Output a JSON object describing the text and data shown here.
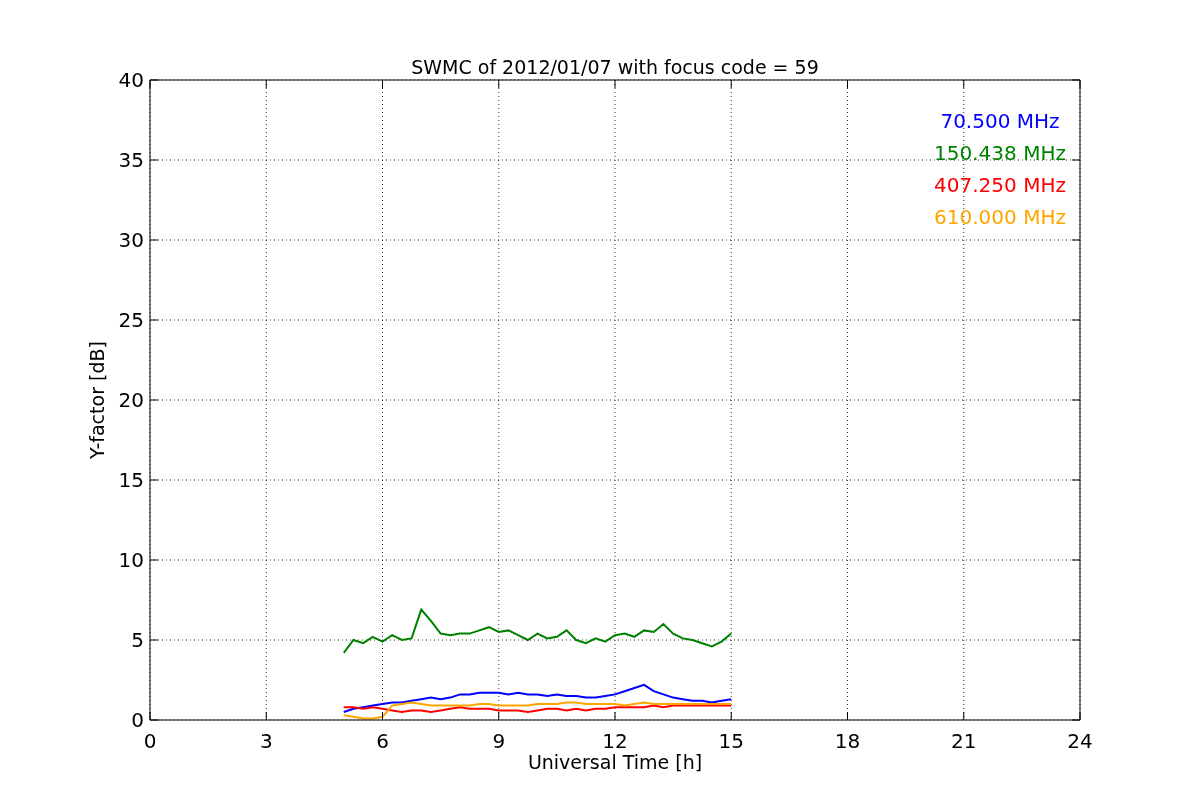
{
  "chart_data": {
    "type": "line",
    "grid": true,
    "title": "SWMC of 2012/01/07 with focus code = 59",
    "xlabel": "Universal Time [h]",
    "ylabel": "Y-factor [dB]",
    "xlim": [
      0,
      24
    ],
    "ylim": [
      0,
      40
    ],
    "xticks": [
      0,
      3,
      6,
      9,
      12,
      15,
      18,
      21,
      24
    ],
    "yticks": [
      0,
      5,
      10,
      15,
      20,
      25,
      30,
      35,
      40
    ],
    "x": [
      5,
      5.25,
      5.5,
      5.75,
      6,
      6.25,
      6.5,
      6.75,
      7,
      7.25,
      7.5,
      7.75,
      8,
      8.25,
      8.5,
      8.75,
      9,
      9.25,
      9.5,
      9.75,
      10,
      10.25,
      10.5,
      10.75,
      11,
      11.25,
      11.5,
      11.75,
      12,
      12.25,
      12.5,
      12.75,
      13,
      13.25,
      13.5,
      13.75,
      14,
      14.25,
      14.5,
      14.75,
      15
    ],
    "series": [
      {
        "name": "70.500 MHz",
        "color": "#0000ff",
        "values": [
          0.5,
          0.7,
          0.8,
          0.9,
          1.0,
          1.1,
          1.1,
          1.2,
          1.3,
          1.4,
          1.3,
          1.4,
          1.6,
          1.6,
          1.7,
          1.7,
          1.7,
          1.6,
          1.7,
          1.6,
          1.6,
          1.5,
          1.6,
          1.5,
          1.5,
          1.4,
          1.4,
          1.5,
          1.6,
          1.8,
          2.0,
          2.2,
          1.8,
          1.6,
          1.4,
          1.3,
          1.2,
          1.2,
          1.1,
          1.2,
          1.3
        ]
      },
      {
        "name": "150.438 MHz",
        "color": "#008000",
        "values": [
          4.2,
          5.0,
          4.8,
          5.2,
          4.9,
          5.3,
          5.0,
          5.1,
          6.9,
          6.2,
          5.4,
          5.3,
          5.4,
          5.4,
          5.6,
          5.8,
          5.5,
          5.6,
          5.3,
          5.0,
          5.4,
          5.1,
          5.2,
          5.6,
          5.0,
          4.8,
          5.1,
          4.9,
          5.3,
          5.4,
          5.2,
          5.6,
          5.5,
          6.0,
          5.4,
          5.1,
          5.0,
          4.8,
          4.6,
          4.9,
          5.4
        ]
      },
      {
        "name": "407.250 MHz",
        "color": "#ff0000",
        "values": [
          0.8,
          0.8,
          0.7,
          0.8,
          0.7,
          0.6,
          0.5,
          0.6,
          0.6,
          0.5,
          0.6,
          0.7,
          0.8,
          0.7,
          0.7,
          0.7,
          0.6,
          0.6,
          0.6,
          0.5,
          0.6,
          0.7,
          0.7,
          0.6,
          0.7,
          0.6,
          0.7,
          0.7,
          0.8,
          0.8,
          0.8,
          0.8,
          0.9,
          0.8,
          0.9,
          0.9,
          0.9,
          0.9,
          0.9,
          0.9,
          0.9
        ]
      },
      {
        "name": "610.000 MHz",
        "color": "#ffa500",
        "values": [
          0.3,
          0.2,
          0.1,
          0.1,
          0.2,
          0.9,
          1.0,
          1.1,
          1.0,
          0.9,
          0.9,
          0.9,
          0.9,
          0.9,
          1.0,
          1.0,
          0.9,
          0.9,
          0.9,
          0.9,
          1.0,
          1.0,
          1.0,
          1.1,
          1.1,
          1.0,
          1.0,
          1.0,
          1.0,
          0.9,
          1.0,
          1.1,
          1.0,
          1.0,
          1.0,
          1.0,
          1.0,
          1.0,
          1.0,
          1.0,
          1.0
        ]
      }
    ]
  }
}
